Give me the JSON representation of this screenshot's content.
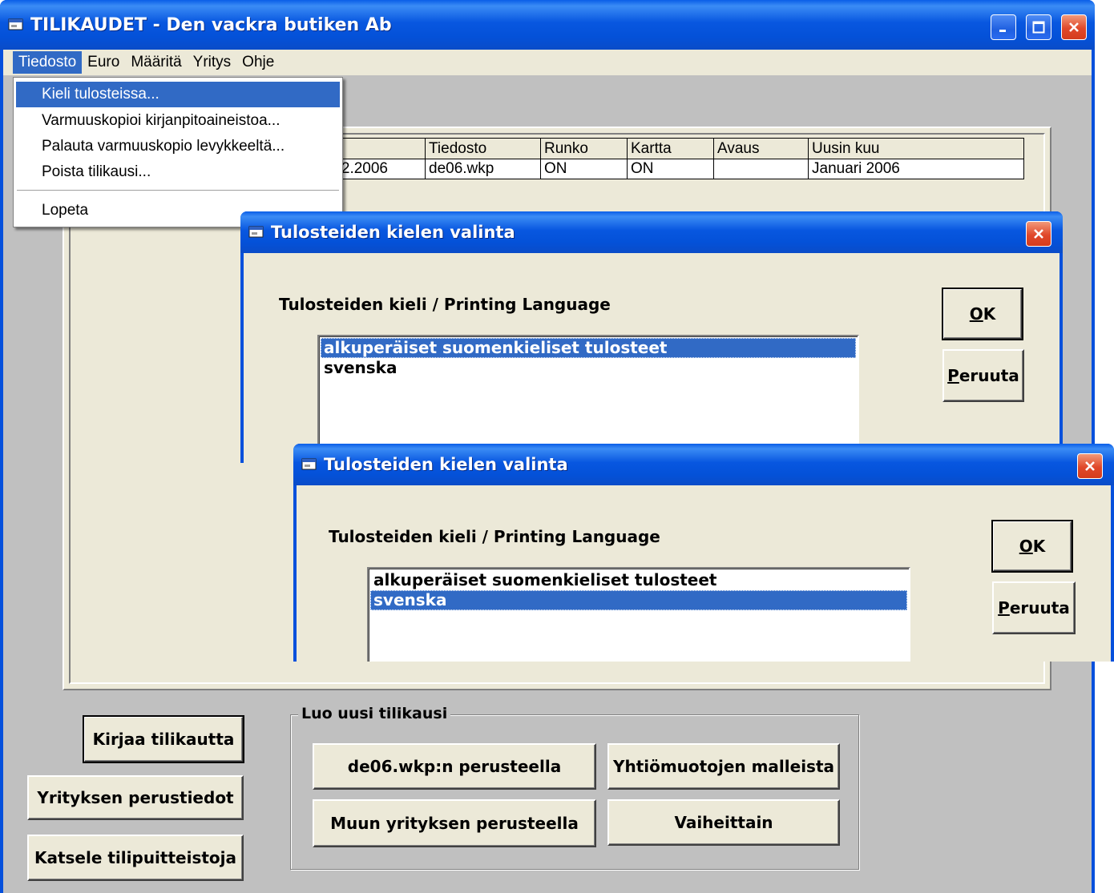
{
  "main_window": {
    "title": "TILIKAUDET - Den vackra butiken Ab",
    "menu": [
      "Tiedosto",
      "Euro",
      "Määritä",
      "Yritys",
      "Ohje"
    ]
  },
  "dropdown": {
    "items": [
      "Kieli tulosteissa...",
      "Varmuuskopioi kirjanpitoaineistoa...",
      "Palauta varmuuskopio levykkeeltä...",
      "Poista tilikausi...",
      "Lopeta"
    ],
    "highlighted": "Kieli tulosteissa..."
  },
  "grid": {
    "headers": [
      "",
      "Tiedosto",
      "Runko",
      "Kartta",
      "Avaus",
      "Uusin kuu"
    ],
    "rows": [
      [
        "2.2006",
        "de06.wkp",
        "ON",
        "ON",
        "",
        "Januari 2006"
      ]
    ]
  },
  "dialog_back": {
    "title": "Tulosteiden kielen valinta",
    "label": "Tulosteiden kieli / Printing Language",
    "options": [
      "alkuperäiset suomenkieliset tulosteet",
      "svenska"
    ],
    "selected": "alkuperäiset suomenkieliset tulosteet",
    "ok_label": "OK",
    "ok_mnemonic": "O",
    "cancel_label": "Peruuta",
    "cancel_mnemonic": "P"
  },
  "dialog_front": {
    "title": "Tulosteiden kielen valinta",
    "label": "Tulosteiden kieli / Printing Language",
    "options": [
      "alkuperäiset suomenkieliset tulosteet",
      "svenska"
    ],
    "selected": "svenska",
    "ok_label": "OK",
    "ok_mnemonic": "O",
    "cancel_label": "Peruuta",
    "cancel_mnemonic": "P"
  },
  "buttons": {
    "kirjaa": "Kirjaa tilikautta",
    "perustiedot": "Yrityksen perustiedot",
    "katsele": "Katsele tilipuitteistoja"
  },
  "new_period": {
    "group_label": "Luo uusi tilikausi",
    "based_on_file": "de06.wkp:n perusteella",
    "from_templates": "Yhtiömuotojen malleista",
    "other_company": "Muun yrityksen perusteella",
    "stepwise": "Vaiheittain"
  },
  "colors": {
    "xp_title_blue": "#0550dc",
    "selection_blue": "#316ac5",
    "button_face": "#ece9d8",
    "client_gray": "#c0c0c0",
    "close_red": "#e0482a"
  }
}
